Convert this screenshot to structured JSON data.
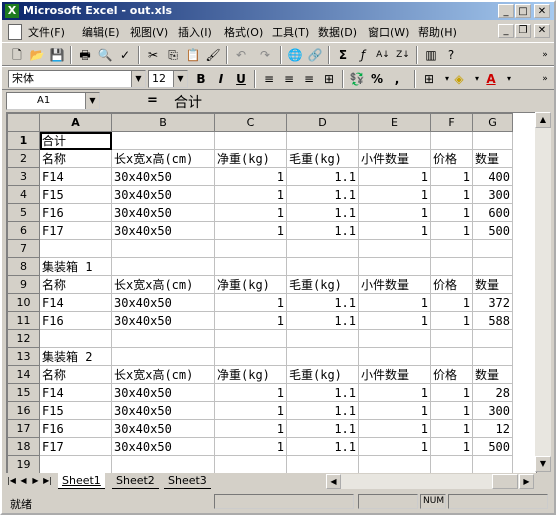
{
  "window": {
    "title": "Microsoft Excel - out.xls",
    "app_icon": "excel-x-icon"
  },
  "menu": [
    "文件(F)",
    "编辑(E)",
    "视图(V)",
    "插入(I)",
    "格式(O)",
    "工具(T)",
    "数据(D)",
    "窗口(W)",
    "帮助(H)"
  ],
  "format_toolbar": {
    "font": "宋体",
    "size": "12",
    "bold": "B",
    "italic": "I",
    "underline": "U",
    "currency": "%",
    "comma": ","
  },
  "formula_bar": {
    "cell_ref": "A1",
    "eq": "=",
    "value": "合计"
  },
  "columns": [
    "A",
    "B",
    "C",
    "D",
    "E",
    "F",
    "G"
  ],
  "rows": [
    [
      "1",
      "合计",
      "",
      "",
      "",
      "",
      "",
      ""
    ],
    [
      "2",
      "名称",
      "长x宽x高(cm)",
      "净重(kg)",
      "毛重(kg)",
      "小件数量",
      "价格",
      "数量"
    ],
    [
      "3",
      "F14",
      "30x40x50",
      "1",
      "1.1",
      "1",
      "1",
      "400"
    ],
    [
      "4",
      "F15",
      "30x40x50",
      "1",
      "1.1",
      "1",
      "1",
      "300"
    ],
    [
      "5",
      "F16",
      "30x40x50",
      "1",
      "1.1",
      "1",
      "1",
      "600"
    ],
    [
      "6",
      "F17",
      "30x40x50",
      "1",
      "1.1",
      "1",
      "1",
      "500"
    ],
    [
      "7",
      "",
      "",
      "",
      "",
      "",
      "",
      ""
    ],
    [
      "8",
      "集装箱 1",
      "",
      "",
      "",
      "",
      "",
      ""
    ],
    [
      "9",
      "名称",
      "长x宽x高(cm)",
      "净重(kg)",
      "毛重(kg)",
      "小件数量",
      "价格",
      "数量"
    ],
    [
      "10",
      "F14",
      "30x40x50",
      "1",
      "1.1",
      "1",
      "1",
      "372"
    ],
    [
      "11",
      "F16",
      "30x40x50",
      "1",
      "1.1",
      "1",
      "1",
      "588"
    ],
    [
      "12",
      "",
      "",
      "",
      "",
      "",
      "",
      ""
    ],
    [
      "13",
      "集装箱 2",
      "",
      "",
      "",
      "",
      "",
      ""
    ],
    [
      "14",
      "名称",
      "长x宽x高(cm)",
      "净重(kg)",
      "毛重(kg)",
      "小件数量",
      "价格",
      "数量"
    ],
    [
      "15",
      "F14",
      "30x40x50",
      "1",
      "1.1",
      "1",
      "1",
      "28"
    ],
    [
      "16",
      "F15",
      "30x40x50",
      "1",
      "1.1",
      "1",
      "1",
      "300"
    ],
    [
      "17",
      "F16",
      "30x40x50",
      "1",
      "1.1",
      "1",
      "1",
      "12"
    ],
    [
      "18",
      "F17",
      "30x40x50",
      "1",
      "1.1",
      "1",
      "1",
      "500"
    ],
    [
      "19",
      "",
      "",
      "",
      "",
      "",
      "",
      ""
    ]
  ],
  "sheets": [
    "Sheet1",
    "Sheet2",
    "Sheet3"
  ],
  "active_sheet": "Sheet1",
  "status": {
    "text": "就绪",
    "num": "NUM"
  }
}
